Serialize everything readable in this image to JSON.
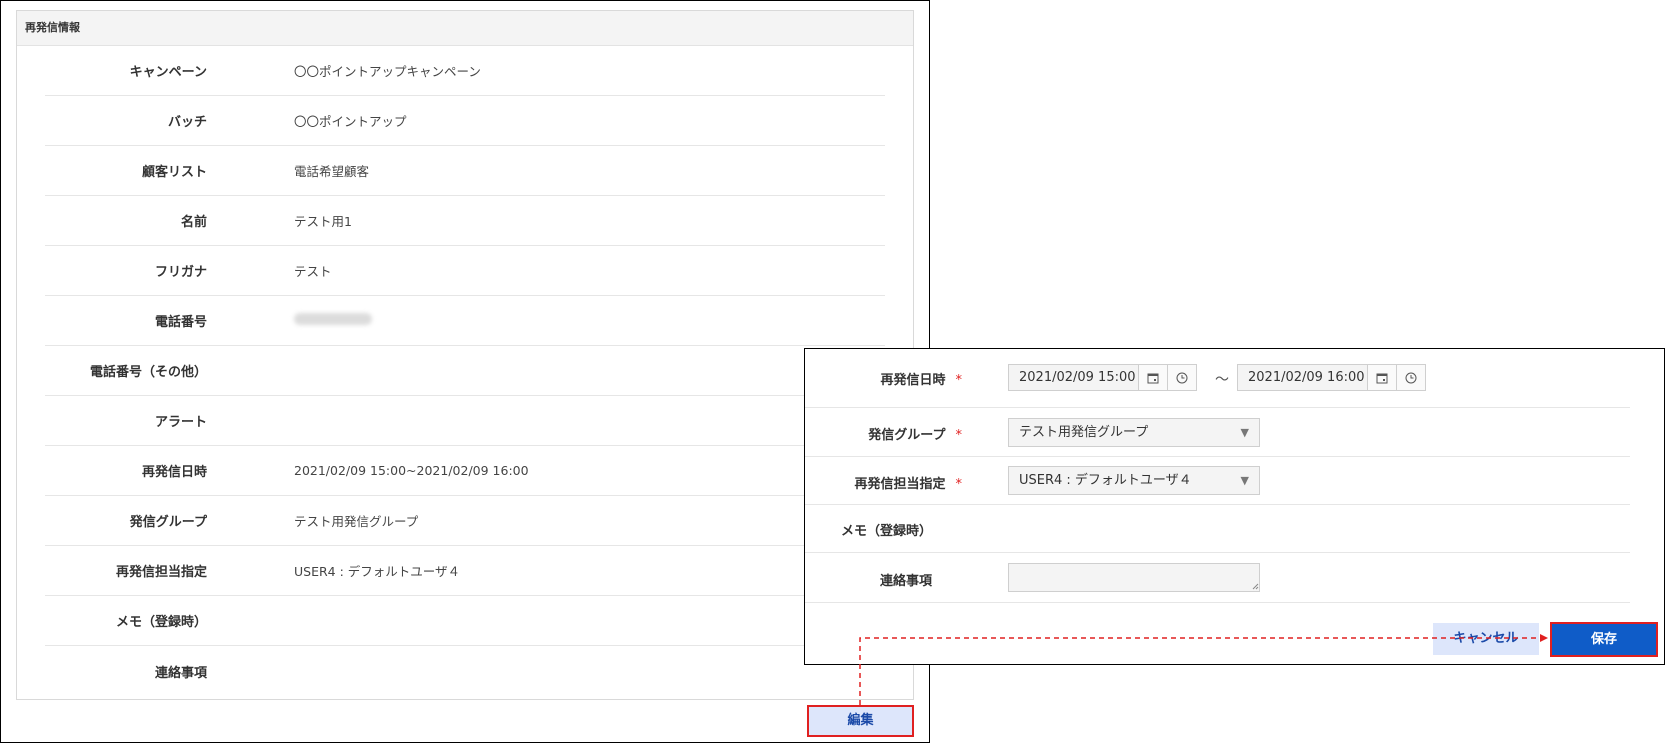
{
  "left_card": {
    "title": "再発信情報",
    "rows": [
      {
        "label": "キャンペーン",
        "value": "〇〇ポイントアップキャンペーン"
      },
      {
        "label": "バッチ",
        "value": "〇〇ポイントアップ"
      },
      {
        "label": "顧客リスト",
        "value": "電話希望顧客"
      },
      {
        "label": "名前",
        "value": "テスト用1"
      },
      {
        "label": "フリガナ",
        "value": "テスト"
      },
      {
        "label": "電話番号",
        "value": ""
      },
      {
        "label": "電話番号（その他）",
        "value": ""
      },
      {
        "label": "アラート",
        "value": ""
      },
      {
        "label": "再発信日時",
        "value": "2021/02/09 15:00~2021/02/09 16:00"
      },
      {
        "label": "発信グループ",
        "value": "テスト用発信グループ"
      },
      {
        "label": "再発信担当指定",
        "value": "USER4 : デフォルトユーザ４"
      },
      {
        "label": "メモ（登録時）",
        "value": ""
      },
      {
        "label": "連絡事項",
        "value": ""
      }
    ],
    "edit_label": "編集"
  },
  "edit_form": {
    "recall_datetime": {
      "label": "再発信日時",
      "required_mark": "*",
      "start_value": "2021/02/09 15:00",
      "end_value": "2021/02/09 16:00",
      "separator": "～"
    },
    "call_group": {
      "label": "発信グループ",
      "required_mark": "*",
      "selected": "テスト用発信グループ",
      "arrow": "▼"
    },
    "assignee": {
      "label": "再発信担当指定",
      "required_mark": "*",
      "selected": "USER4 : デフォルトユーザ４",
      "arrow": "▼"
    },
    "memo": {
      "label": "メモ（登録時）"
    },
    "notes": {
      "label": "連絡事項",
      "value": ""
    },
    "cancel_label": "キャンセル",
    "save_label": "保存"
  },
  "colors": {
    "highlight_border": "#e02020",
    "primary_button": "#0f5cc8",
    "secondary_button": "#dde6fb",
    "required": "#e02020"
  },
  "icons": [
    "calendar-icon",
    "clock-icon",
    "select-arrow-icon",
    "resize-grip-icon"
  ]
}
